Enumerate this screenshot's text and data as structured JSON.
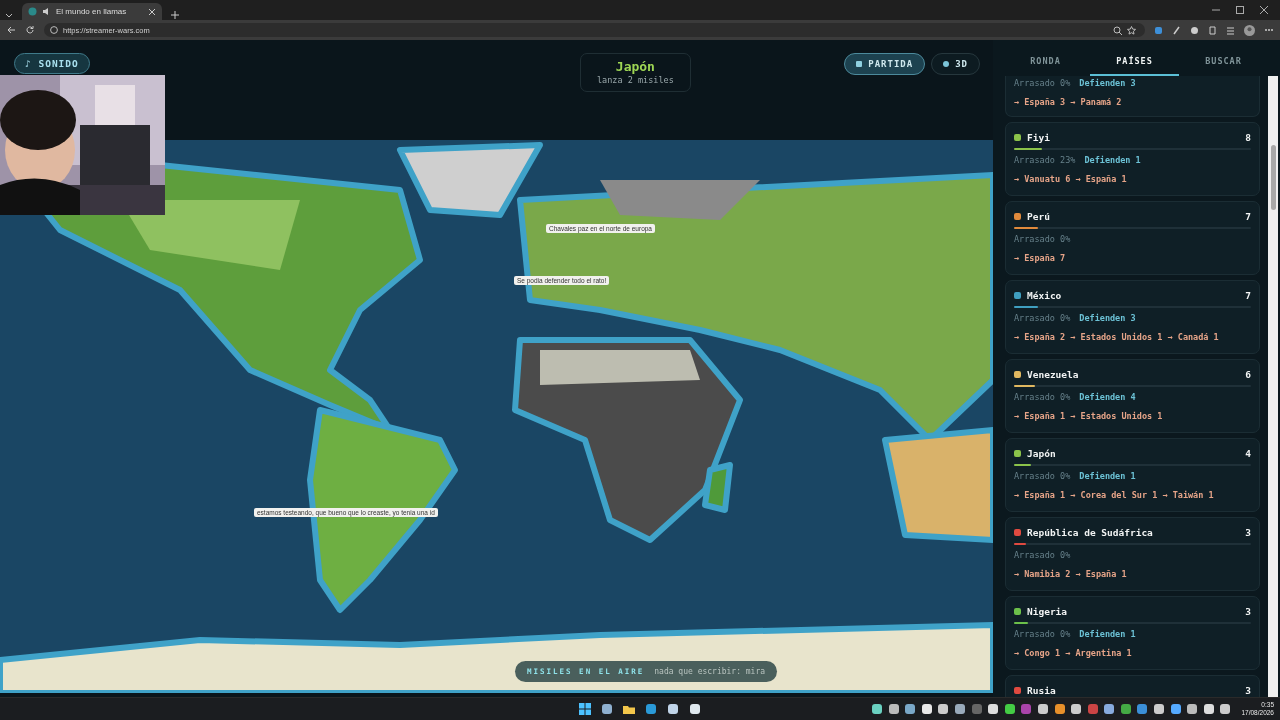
{
  "browser": {
    "tab_title": "El mundo en llamas",
    "url": "https://streamer-wars.com"
  },
  "header": {
    "sound_button": "♪ SONIDO",
    "current": {
      "country": "Japón",
      "action": "lanza 2 misiles"
    },
    "match_button": "PARTIDA",
    "view_button": "3D"
  },
  "map": {
    "kind": "picture",
    "chat_bubbles": [
      "Chavales paz en el norte de europa",
      "Se podia defender todo el rato!",
      "estamos testeando, que bueno que lo creaste, yo tenia una id"
    ]
  },
  "missiles_bar": {
    "label": "MISILES EN EL AIRE",
    "message": "nada que escribir: mira"
  },
  "panel": {
    "tabs": [
      {
        "label": "RONDA",
        "selected": false
      },
      {
        "label": "PAÍSES",
        "selected": true
      },
      {
        "label": "BUSCAR",
        "selected": false
      }
    ],
    "countries": [
      {
        "kind": "partial",
        "razed": "Arrasado 0%",
        "defenders": "Defienden 3",
        "targets": "→ España 3 → Panamá 2"
      },
      {
        "kind": "full",
        "name": "Fiyi",
        "count": "8",
        "color": "#8bc34a",
        "level": 0.12,
        "razed": "Arrasado 23%",
        "defenders": "Defienden 1",
        "targets": "→ Vanuatu 6 → España 1"
      },
      {
        "kind": "full",
        "name": "Perú",
        "count": "7",
        "color": "#e08a3c",
        "level": 0.1,
        "razed": "Arrasado 0%",
        "targets": "→ España 7"
      },
      {
        "kind": "full",
        "name": "México",
        "count": "7",
        "color": "#3f9fc0",
        "level": 0.1,
        "razed": "Arrasado 0%",
        "defenders": "Defienden 3",
        "targets": "→ España 2 → Estados Unidos 1 → Canadá 1"
      },
      {
        "kind": "full",
        "name": "Venezuela",
        "count": "6",
        "color": "#e0b860",
        "level": 0.09,
        "razed": "Arrasado 0%",
        "defenders": "Defienden 4",
        "targets": "→ España 1 → Estados Unidos 1"
      },
      {
        "kind": "full",
        "name": "Japón",
        "count": "4",
        "color": "#8bc34a",
        "level": 0.07,
        "razed": "Arrasado 0%",
        "defenders": "Defienden 1",
        "targets": "→ España 1 → Corea del Sur 1 → Taiwán 1"
      },
      {
        "kind": "full",
        "name": "República de Sudáfrica",
        "count": "3",
        "color": "#e04a40",
        "level": 0.05,
        "razed": "Arrasado 0%",
        "targets": "→ Namibia 2 → España 1"
      },
      {
        "kind": "full",
        "name": "Nigeria",
        "count": "3",
        "color": "#6cc04a",
        "level": 0.06,
        "razed": "Arrasado 0%",
        "defenders": "Defienden 1",
        "targets": "→ Congo 1 → Argentina 1"
      },
      {
        "kind": "full",
        "name": "Rusia",
        "count": "3",
        "color": "#e04a40"
      }
    ]
  },
  "taskbar": {
    "time": "0:35",
    "date": "17/08/2026"
  }
}
